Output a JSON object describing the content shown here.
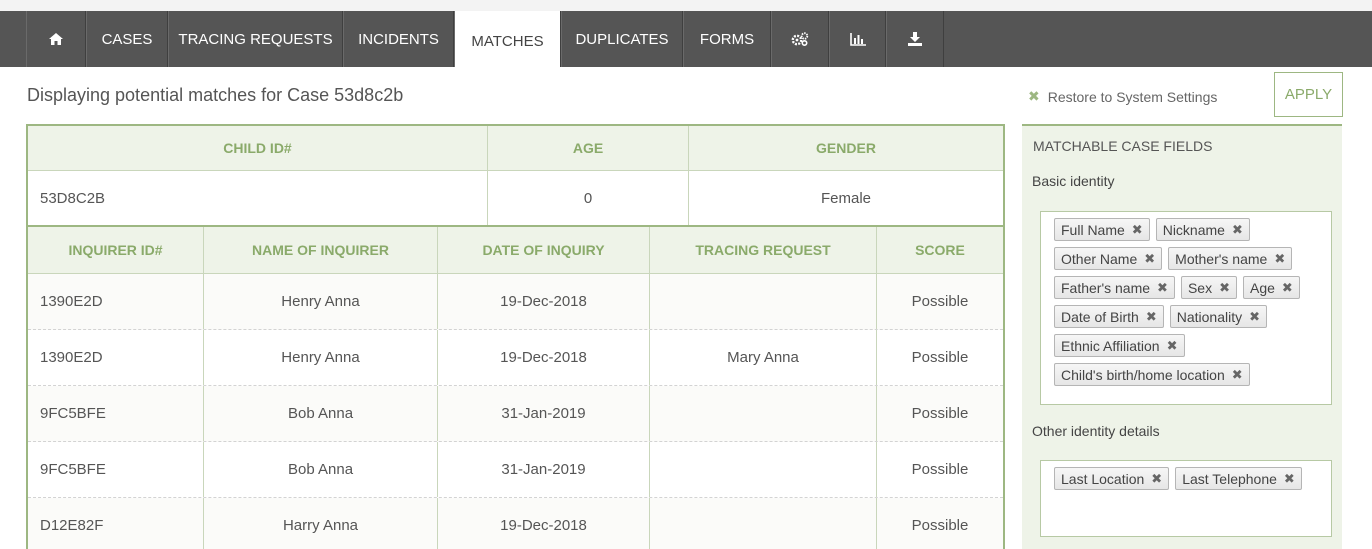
{
  "nav": {
    "tabs": [
      {
        "label": "",
        "icon": "home-icon"
      },
      {
        "label": "CASES"
      },
      {
        "label": "TRACING REQUESTS"
      },
      {
        "label": "INCIDENTS"
      },
      {
        "label": "MATCHES",
        "active": true
      },
      {
        "label": "DUPLICATES"
      },
      {
        "label": "FORMS"
      },
      {
        "label": "",
        "icon": "gears-icon"
      },
      {
        "label": "",
        "icon": "bar-chart-icon"
      },
      {
        "label": "",
        "icon": "download-icon"
      }
    ]
  },
  "page": {
    "title": "Displaying potential matches for Case 53d8c2b"
  },
  "case_table": {
    "headers": [
      "CHILD ID#",
      "AGE",
      "GENDER"
    ],
    "row": [
      "53D8C2B",
      "0",
      "Female"
    ]
  },
  "match_table": {
    "headers": [
      "INQUIRER ID#",
      "NAME OF INQUIRER",
      "DATE OF INQUIRY",
      "TRACING REQUEST",
      "SCORE"
    ],
    "rows": [
      [
        "1390E2D",
        "Henry Anna",
        "19-Dec-2018",
        "",
        "Possible"
      ],
      [
        "1390E2D",
        "Henry Anna",
        "19-Dec-2018",
        "Mary Anna",
        "Possible"
      ],
      [
        "9FC5BFE",
        "Bob Anna",
        "31-Jan-2019",
        "",
        "Possible"
      ],
      [
        "9FC5BFE",
        "Bob Anna",
        "31-Jan-2019",
        "",
        "Possible"
      ],
      [
        "D12E82F",
        "Harry Anna",
        "19-Dec-2018",
        "",
        "Possible"
      ]
    ]
  },
  "settings": {
    "restore_label": "Restore to System Settings",
    "apply_label": "APPLY",
    "panel_title": "MATCHABLE CASE FIELDS",
    "basic_label": "Basic identity",
    "basic_tags": [
      "Full Name",
      "Nickname",
      "Other Name",
      "Mother's name",
      "Father's name",
      "Sex",
      "Age",
      "Date of Birth",
      "Nationality",
      "Ethnic Affiliation",
      "Child's birth/home location"
    ],
    "other_label": "Other identity details",
    "other_tags": [
      "Last Location",
      "Last Telephone"
    ]
  },
  "colors": {
    "navbar": "#555555",
    "accent_green": "#9db782",
    "header_text": "#8aaa6a",
    "panel_bg": "#eef3e8"
  }
}
